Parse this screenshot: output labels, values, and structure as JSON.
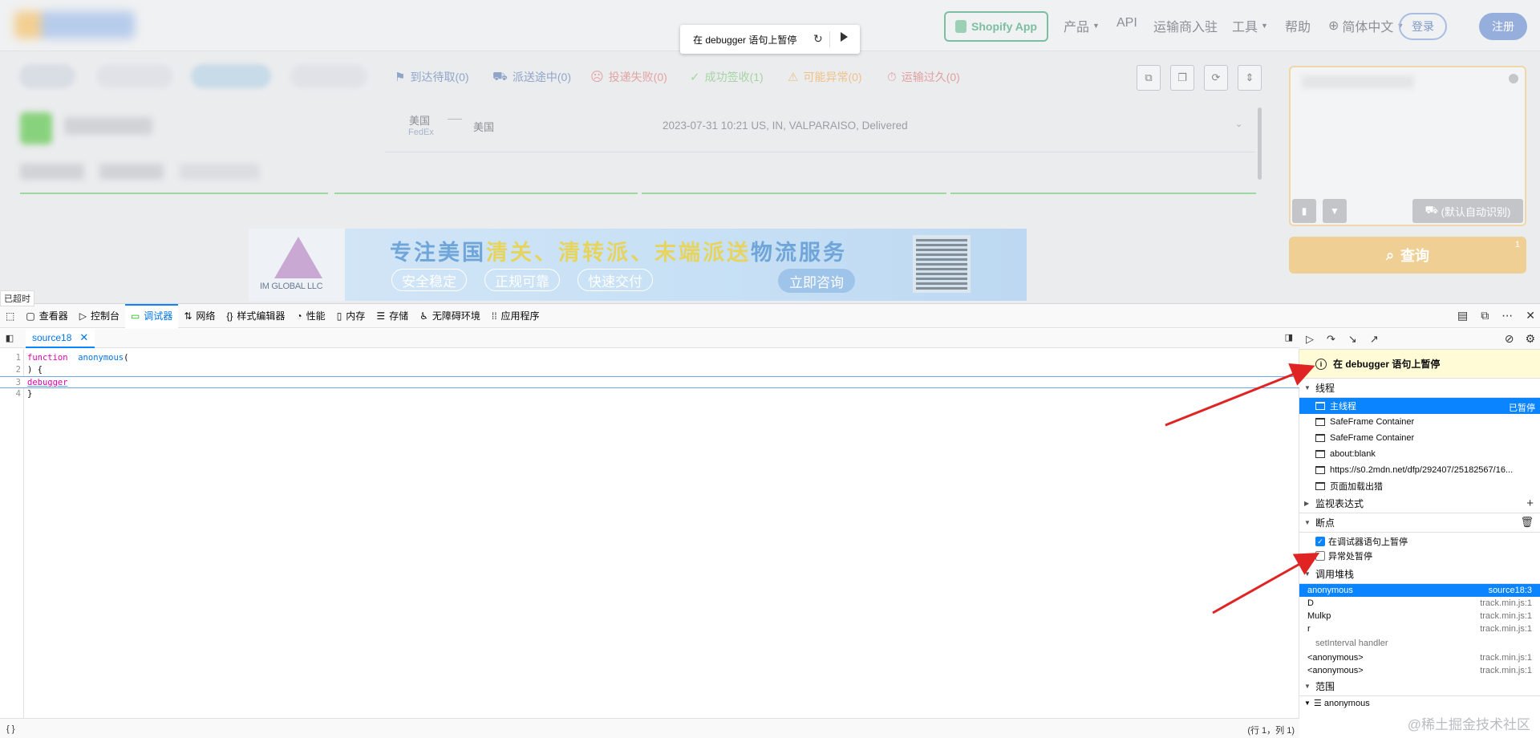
{
  "pause_overlay": {
    "text": "在 debugger 语句上暂停"
  },
  "header": {
    "shopify": "Shopify App",
    "nav": [
      {
        "label": "产品",
        "caret": true
      },
      {
        "label": "API",
        "caret": false
      },
      {
        "label": "运输商入驻",
        "caret": false
      },
      {
        "label": "工具",
        "caret": true
      },
      {
        "label": "帮助",
        "caret": false
      },
      {
        "label": "简体中文",
        "caret": true
      }
    ],
    "login": "登录",
    "register": "注册"
  },
  "status_tabs": [
    {
      "label": "到达待取(0)",
      "color": "#8fa6c9"
    },
    {
      "label": "派送途中(0)",
      "color": "#8fa6c9"
    },
    {
      "label": "投递失败(0)",
      "color": "#e3a3a3"
    },
    {
      "label": "成功签收(1)",
      "color": "#a6d3a3"
    },
    {
      "label": "可能异常(0)",
      "color": "#eec189"
    },
    {
      "label": "运输过久(0)",
      "color": "#e0a0a0"
    }
  ],
  "result": {
    "origin": "美国",
    "carrier": "FedEx",
    "destination": "美国",
    "event": "2023-07-31 10:21  US, IN, VALPARAISO, Delivered"
  },
  "banner": {
    "logo": "IM GLOBAL LLC",
    "title_a": "专注美国",
    "title_b": "清关、清转派、末端派送",
    "title_c": "物流服务",
    "pills": [
      "安全稳定",
      "正规可靠",
      "快速交付"
    ],
    "cta": "立即咨询"
  },
  "side": {
    "carrier_select": "(默认自动识别)",
    "query": "查询",
    "query_badge": "1"
  },
  "timeout_label": "已超时",
  "devtools": {
    "tabs": [
      {
        "label": "查看器",
        "icon": "inspector-icon"
      },
      {
        "label": "控制台",
        "icon": "console-icon"
      },
      {
        "label": "调试器",
        "icon": "debugger-icon",
        "active": true
      },
      {
        "label": "网络",
        "icon": "network-icon"
      },
      {
        "label": "样式编辑器",
        "icon": "style-editor-icon"
      },
      {
        "label": "性能",
        "icon": "performance-icon"
      },
      {
        "label": "内存",
        "icon": "memory-icon"
      },
      {
        "label": "存储",
        "icon": "storage-icon"
      },
      {
        "label": "无障碍环境",
        "icon": "accessibility-icon"
      },
      {
        "label": "应用程序",
        "icon": "application-icon"
      }
    ],
    "source_tab": "source18",
    "code": [
      {
        "n": "1",
        "parts": [
          [
            "kw",
            "function"
          ],
          [
            "",
            "  "
          ],
          [
            "fn",
            "anonymous"
          ],
          [
            "",
            "("
          ]
        ]
      },
      {
        "n": "2",
        "parts": [
          [
            "",
            ") {"
          ]
        ]
      },
      {
        "n": "3",
        "parts": [
          [
            "kw",
            "debugger"
          ]
        ],
        "paused": true
      },
      {
        "n": "4",
        "parts": [
          [
            "",
            "}"
          ]
        ]
      }
    ],
    "status_pretty": "{ }",
    "cursor": "(行 1，列 1)",
    "paused_message": "在 debugger 语句上暂停",
    "sections": {
      "threads": "线程",
      "watch": "监视表达式",
      "breakpoints": "断点",
      "callstack": "调用堆栈",
      "scopes": "范围"
    },
    "threads": [
      {
        "label": "主线程",
        "state": "已暂停",
        "selected": true
      },
      {
        "label": "SafeFrame Container"
      },
      {
        "label": "SafeFrame Container"
      },
      {
        "label": "about:blank"
      },
      {
        "label": "https://s0.2mdn.net/dfp/292407/25182567/16..."
      },
      {
        "label": "页面加载出猎"
      }
    ],
    "breakpoint_options": [
      {
        "label": "在调试器语句上暂停",
        "checked": true
      },
      {
        "label": "异常处暂停",
        "checked": false
      }
    ],
    "frames": [
      {
        "name": "anonymous",
        "loc": "source18:3",
        "selected": true
      },
      {
        "name": "D",
        "loc": "track.min.js:1"
      },
      {
        "name": "Mulkp",
        "loc": "track.min.js:1"
      },
      {
        "name": "r",
        "loc": "track.min.js:1"
      },
      {
        "name": "setInterval handler",
        "loc": "",
        "group": true
      },
      {
        "name": "<anonymous>",
        "loc": "track.min.js:1"
      },
      {
        "name": "<anonymous>",
        "loc": "track.min.js:1"
      }
    ],
    "scope_first": "☰ anonymous"
  },
  "watermark": "@稀土掘金技术社区",
  "colors": {
    "accent": "#0a84ff",
    "arrow": "#e02424"
  }
}
